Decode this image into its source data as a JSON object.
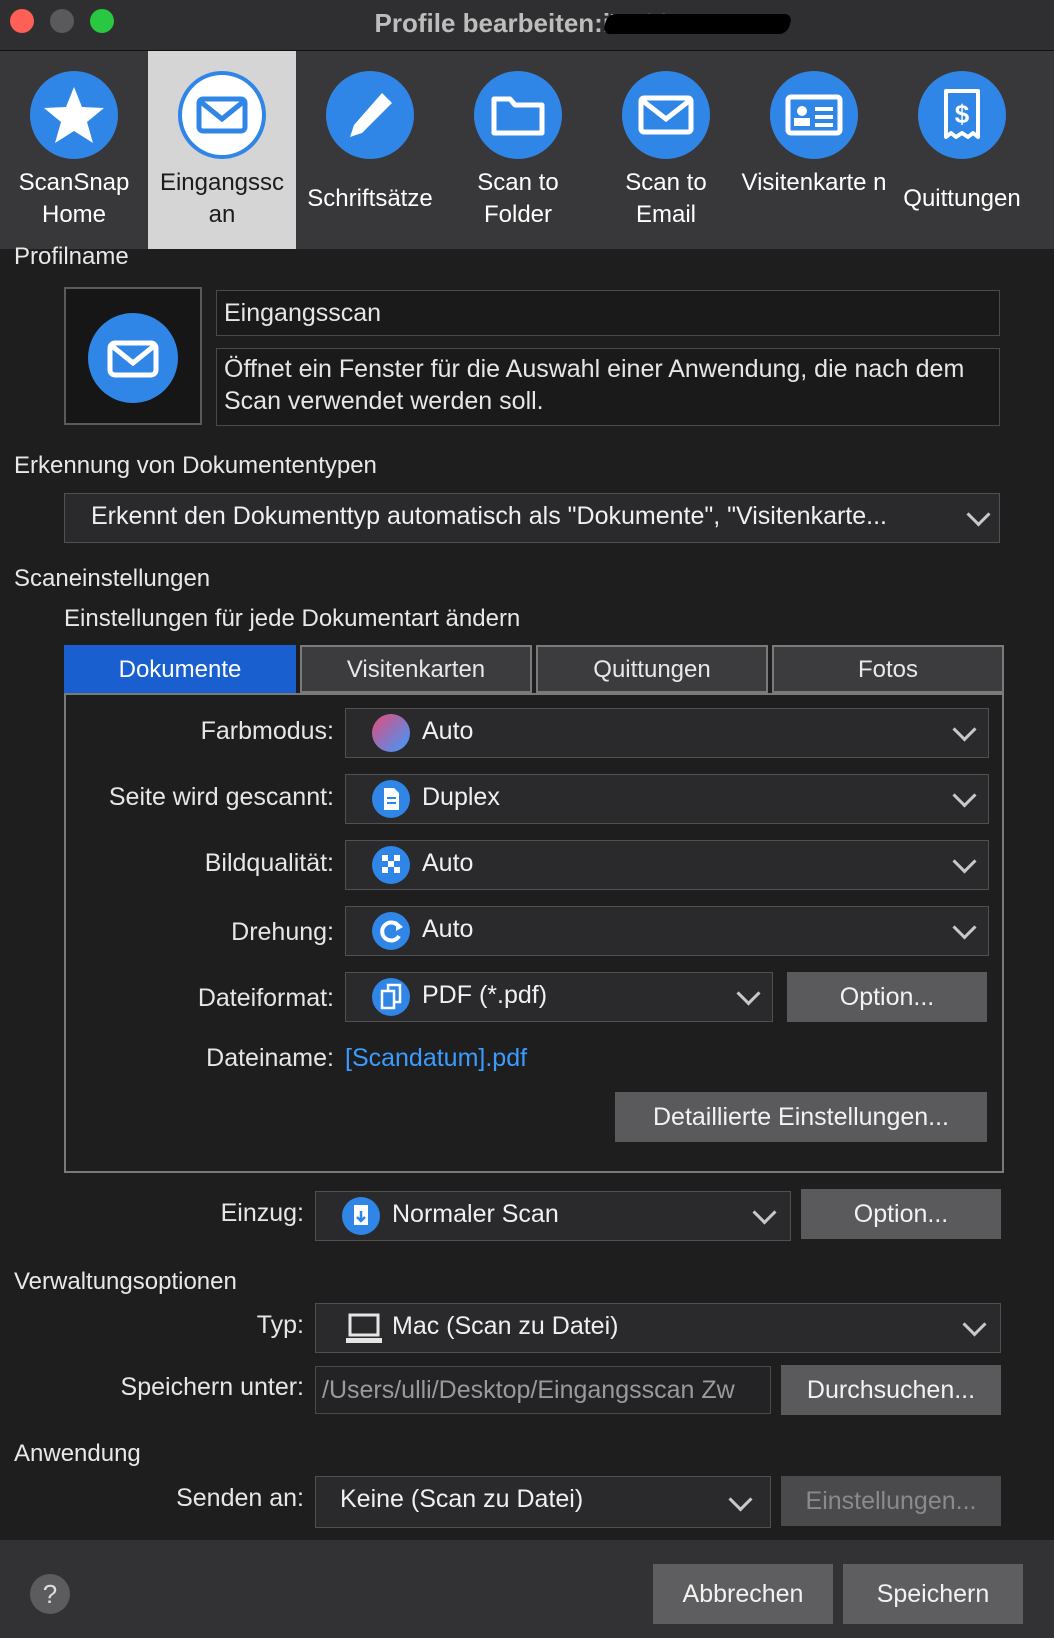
{
  "window": {
    "title": "Profile bearbeiten:iX500-"
  },
  "toolbar": {
    "items": [
      {
        "label": "ScanSnap Home"
      },
      {
        "label": "Eingangssc an"
      },
      {
        "label": "Schriftsätze"
      },
      {
        "label": "Scan to Folder"
      },
      {
        "label": "Scan to Email"
      },
      {
        "label": "Visitenkarte n"
      },
      {
        "label": "Quittungen"
      }
    ],
    "active_index": 1
  },
  "profile": {
    "section_label": "Profilname",
    "name": "Eingangsscan",
    "description": "Öffnet ein Fenster für die Auswahl einer Anwendung, die nach dem Scan verwendet werden soll."
  },
  "doc_detection": {
    "section_label": "Erkennung von Dokumententypen",
    "value": "Erkennt den Dokumenttyp automatisch als \"Dokumente\", \"Visitenkarte..."
  },
  "scan_settings": {
    "section_label": "Scaneinstellungen",
    "sub_label": "Einstellungen für jede Dokumentart ändern",
    "tabs": [
      "Dokumente",
      "Visitenkarten",
      "Quittungen",
      "Fotos"
    ],
    "active_tab": 0,
    "color_mode": {
      "label": "Farbmodus:",
      "value": "Auto"
    },
    "sides": {
      "label": "Seite wird gescannt:",
      "value": "Duplex"
    },
    "quality": {
      "label": "Bildqualität:",
      "value": "Auto"
    },
    "rotation": {
      "label": "Drehung:",
      "value": "Auto"
    },
    "file_format": {
      "label": "Dateiformat:",
      "value": "PDF (*.pdf)",
      "option_button": "Option..."
    },
    "file_name": {
      "label": "Dateiname:",
      "value": "[Scandatum].pdf"
    },
    "detailed_button": "Detaillierte Einstellungen..."
  },
  "feed": {
    "label": "Einzug:",
    "value": "Normaler Scan",
    "option_button": "Option..."
  },
  "management": {
    "section_label": "Verwaltungsoptionen",
    "type": {
      "label": "Typ:",
      "value": "Mac (Scan zu Datei)"
    },
    "save_to": {
      "label": "Speichern unter:",
      "value": "/Users/ulli/Desktop/Eingangsscan Zw",
      "browse_button": "Durchsuchen..."
    }
  },
  "application": {
    "section_label": "Anwendung",
    "send_to": {
      "label": "Senden an:",
      "value": "Keine (Scan zu Datei)",
      "settings_button": "Einstellungen..."
    }
  },
  "footer": {
    "help": "?",
    "cancel": "Abbrechen",
    "save": "Speichern"
  },
  "colors": {
    "accent": "#2f86e6",
    "tab_active": "#1a5fd0",
    "link": "#3a9cff"
  }
}
